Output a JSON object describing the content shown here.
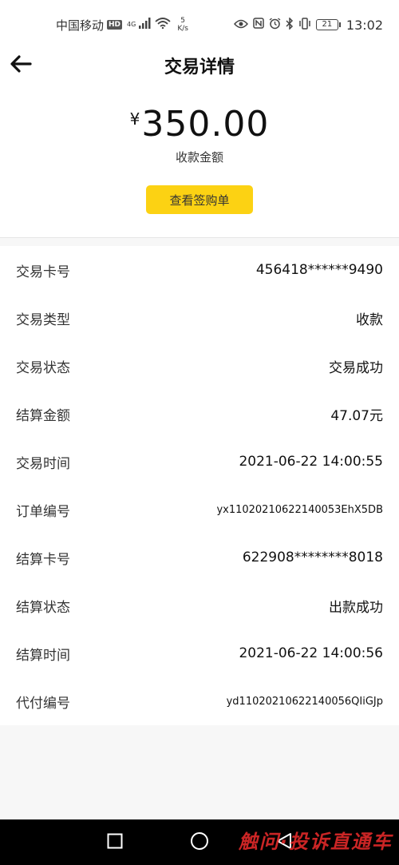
{
  "status_bar": {
    "carrier": "中国移动",
    "hd": "HD",
    "net_type": "4G",
    "speed_value": "5",
    "speed_unit": "K/s",
    "battery": "21",
    "time": "13:02"
  },
  "header": {
    "title": "交易详情",
    "back_icon": "arrow-left-icon"
  },
  "summary": {
    "currency": "¥",
    "amount": "350.00",
    "amount_label": "收款金额",
    "receipt_button": "查看签购单"
  },
  "details": [
    {
      "label": "交易卡号",
      "value": "456418******9490"
    },
    {
      "label": "交易类型",
      "value": "收款"
    },
    {
      "label": "交易状态",
      "value": "交易成功"
    },
    {
      "label": "结算金额",
      "value": "47.07元"
    },
    {
      "label": "交易时间",
      "value": "2021-06-22 14:00:55"
    },
    {
      "label": "订单编号",
      "value": "yx11020210622140053EhX5DB"
    },
    {
      "label": "结算卡号",
      "value": "622908********8018"
    },
    {
      "label": "结算状态",
      "value": "出款成功"
    },
    {
      "label": "结算时间",
      "value": "2021-06-22 14:00:56"
    },
    {
      "label": "代付编号",
      "value": "yd11020210622140056QIiGJp"
    }
  ],
  "nav_bar": {
    "icons": [
      "square-recents-icon",
      "circle-home-icon",
      "triangle-back-icon"
    ]
  },
  "watermark": "触问·投诉直通车",
  "colors": {
    "accent": "#fcd213",
    "page_bg": "#f7f7f7",
    "nav_bg": "#000000",
    "watermark": "#e02a2a"
  }
}
